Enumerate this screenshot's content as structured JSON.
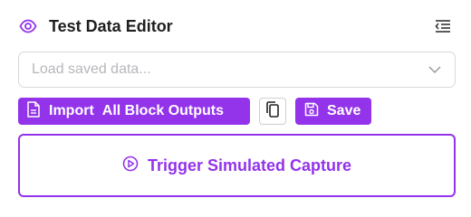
{
  "header": {
    "title": "Test Data Editor",
    "icon": "eye-icon",
    "action_icon": "collapse-menu-icon"
  },
  "load_select": {
    "placeholder": "Load saved data...",
    "icon": "chevron-down-icon"
  },
  "toolbar": {
    "import_label": "Import",
    "import_target_label": "All Block Outputs",
    "import_icon": "document-icon",
    "copy_icon": "copy-icon",
    "save_label": "Save",
    "save_icon": "save-icon"
  },
  "trigger": {
    "label": "Trigger Simulated Capture",
    "icon": "play-circle-icon"
  },
  "colors": {
    "accent": "#9333ea",
    "text": "#1f1f1f",
    "placeholder": "#b7b7bc",
    "border": "#d9d9dc"
  }
}
